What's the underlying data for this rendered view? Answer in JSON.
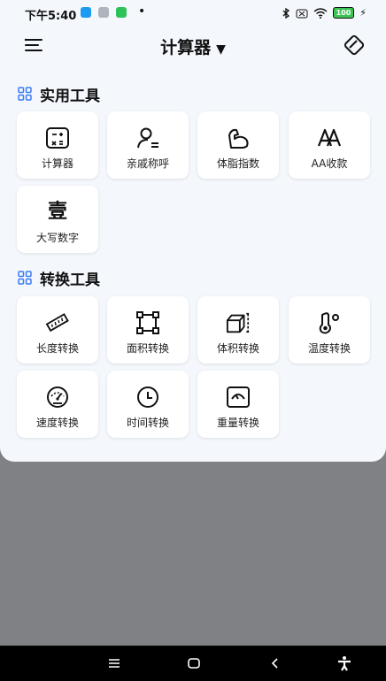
{
  "status": {
    "time": "下午5:40",
    "battery": "100"
  },
  "header": {
    "title": "计算器",
    "caret": "▼"
  },
  "sections": [
    {
      "title": "实用工具",
      "items": [
        {
          "label": "计算器",
          "icon": "calculator-icon"
        },
        {
          "label": "亲戚称呼",
          "icon": "person-icon"
        },
        {
          "label": "体脂指数",
          "icon": "flex-arm-icon"
        },
        {
          "label": "AA收款",
          "icon": "aa-icon"
        },
        {
          "label": "大写数字",
          "icon": "uppercase-number-icon",
          "glyph": "壹"
        }
      ]
    },
    {
      "title": "转换工具",
      "items": [
        {
          "label": "长度转换",
          "icon": "ruler-icon"
        },
        {
          "label": "面积转换",
          "icon": "area-icon"
        },
        {
          "label": "体积转换",
          "icon": "cube-icon"
        },
        {
          "label": "温度转换",
          "icon": "thermometer-icon"
        },
        {
          "label": "速度转换",
          "icon": "speedometer-icon"
        },
        {
          "label": "时间转换",
          "icon": "clock-icon"
        },
        {
          "label": "重量转换",
          "icon": "scale-icon"
        }
      ]
    }
  ]
}
